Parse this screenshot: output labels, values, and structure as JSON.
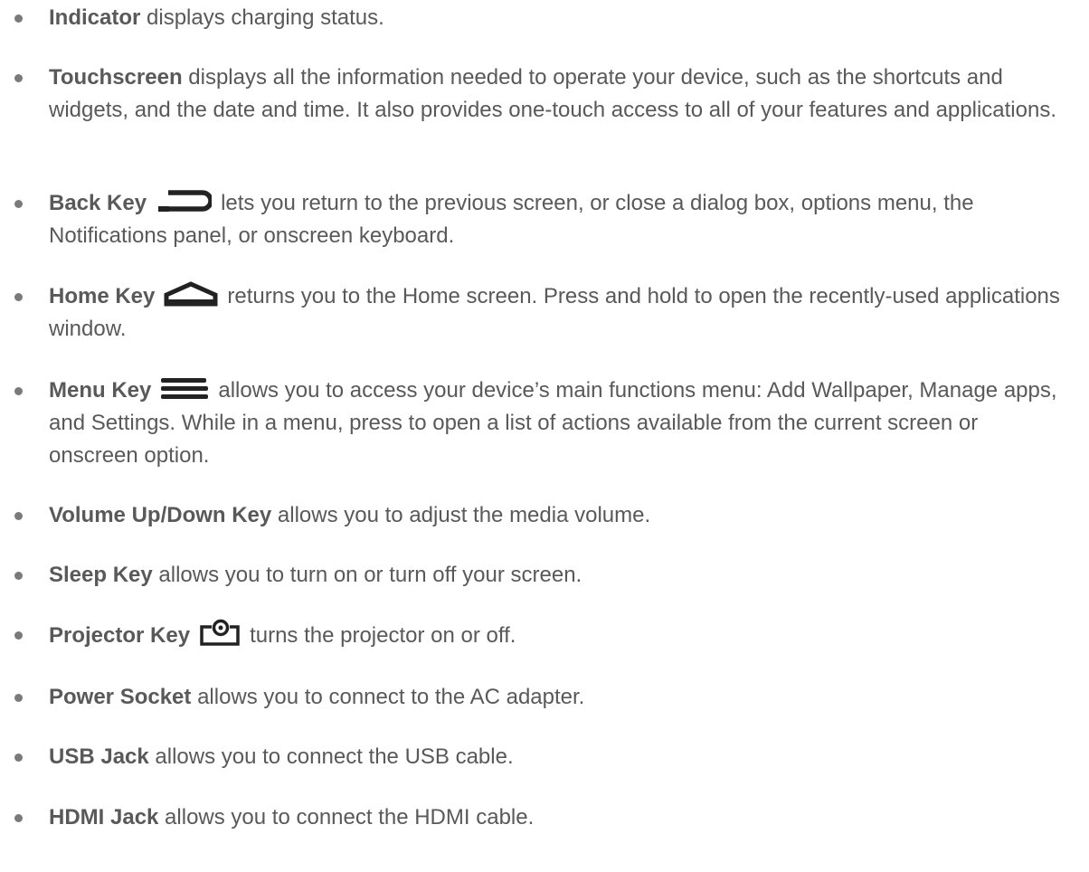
{
  "items": [
    {
      "term": "Indicator",
      "desc": " displays charging status."
    },
    {
      "term": "Touchscreen",
      "desc": " displays all the information needed to operate your device, such as the shortcuts and widgets, and the date and time. It also provides one-touch access to all of your features and applications."
    },
    {
      "term": "Back Key",
      "icon": "back-arrow-icon",
      "desc": "lets you return to the previous screen, or close a dialog box, options menu, the Notifications panel, or onscreen keyboard."
    },
    {
      "term": "Home Key",
      "icon": "home-icon",
      "desc": "returns you to the Home screen. Press and hold to open the recently-used applications window."
    },
    {
      "term": "Menu Key",
      "icon": "menu-icon",
      "desc": "allows you to access your device’s main functions menu: Add Wallpaper, Manage apps, and Settings. While in a menu, press to open a list of actions available from the current screen or onscreen option."
    },
    {
      "term": "Volume Up/Down Key",
      "desc": " allows you to adjust the media volume."
    },
    {
      "term": "Sleep Key",
      "desc": " allows you to turn on or turn off your screen."
    },
    {
      "term": "Projector Key",
      "icon": "projector-icon",
      "desc": "turns the projector on or off."
    },
    {
      "term": "Power Socket",
      "desc": " allows you to connect to the AC adapter."
    },
    {
      "term": "USB Jack",
      "desc": " allows you to connect the USB cable."
    },
    {
      "term": "HDMI Jack",
      "desc": " allows you to connect the HDMI cable."
    }
  ],
  "colors": {
    "text": "#595959",
    "icon": "#222222",
    "bullet": "#7a7a7a"
  }
}
